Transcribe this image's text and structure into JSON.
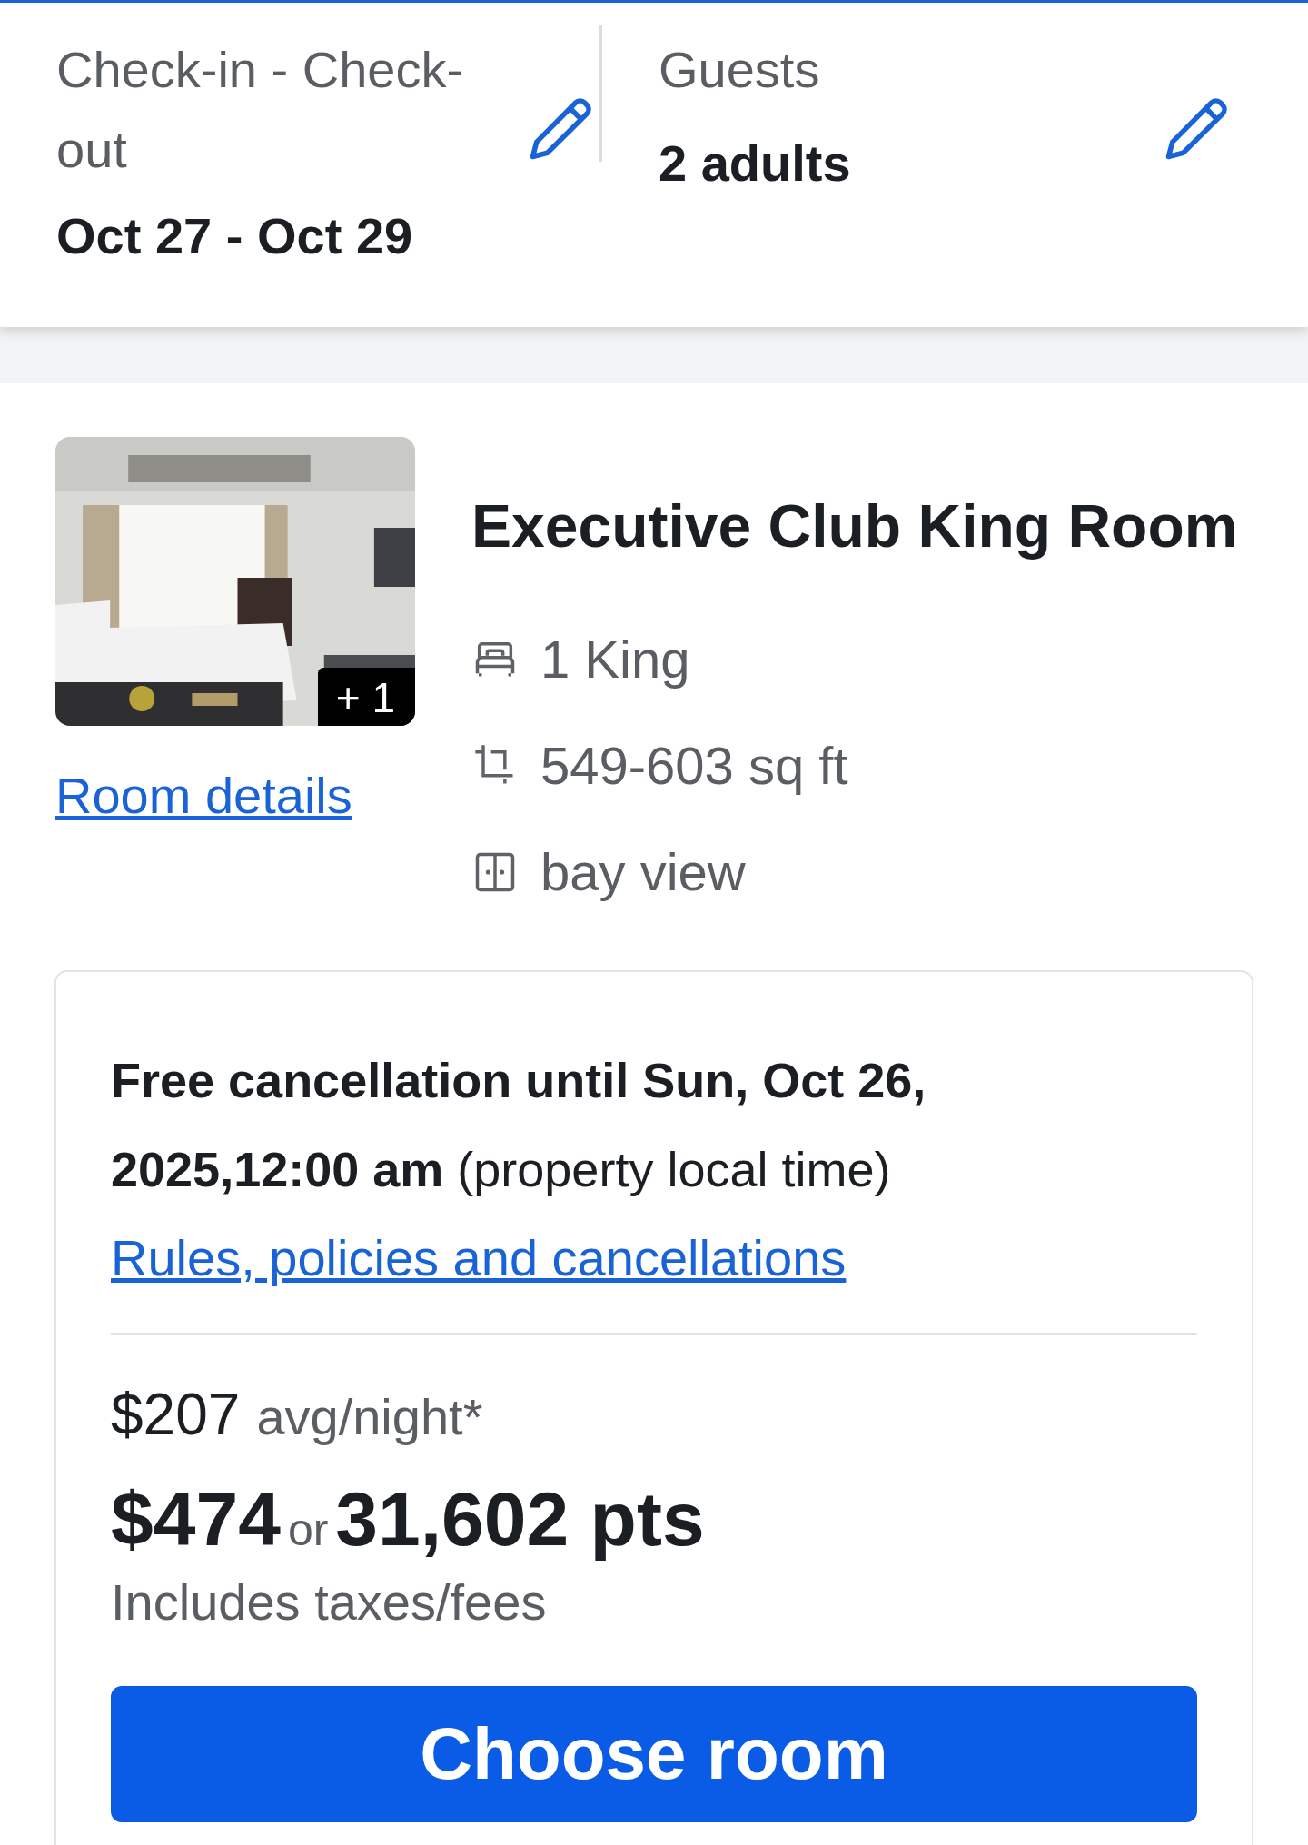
{
  "search_summary": {
    "dates": {
      "label": "Check-in - Check-out",
      "value": "Oct 27 - Oct 29"
    },
    "guests": {
      "label": "Guests",
      "value": "2 adults"
    }
  },
  "room": {
    "photo": {
      "kind": "picture",
      "more_count": "+ 1"
    },
    "details_link": "Room details",
    "name": "Executive Club King Room",
    "amenities": [
      {
        "kind": "bed",
        "text": "1 King"
      },
      {
        "kind": "area",
        "text": "549-603 sq ft"
      },
      {
        "kind": "view",
        "text": "bay view"
      }
    ]
  },
  "rate": {
    "cancellation": "**Free cancellation until Sun, Oct 26, 2025,12:00 am** (property local time)",
    "policy_link": "Rules, policies and cancellations",
    "nightly_price": "$207",
    "nightly_unit": "avg/night*",
    "total_price": "$474",
    "or": "or",
    "points": "31,602 pts",
    "total_note": "Includes taxes/fees",
    "button": "Choose room"
  }
}
